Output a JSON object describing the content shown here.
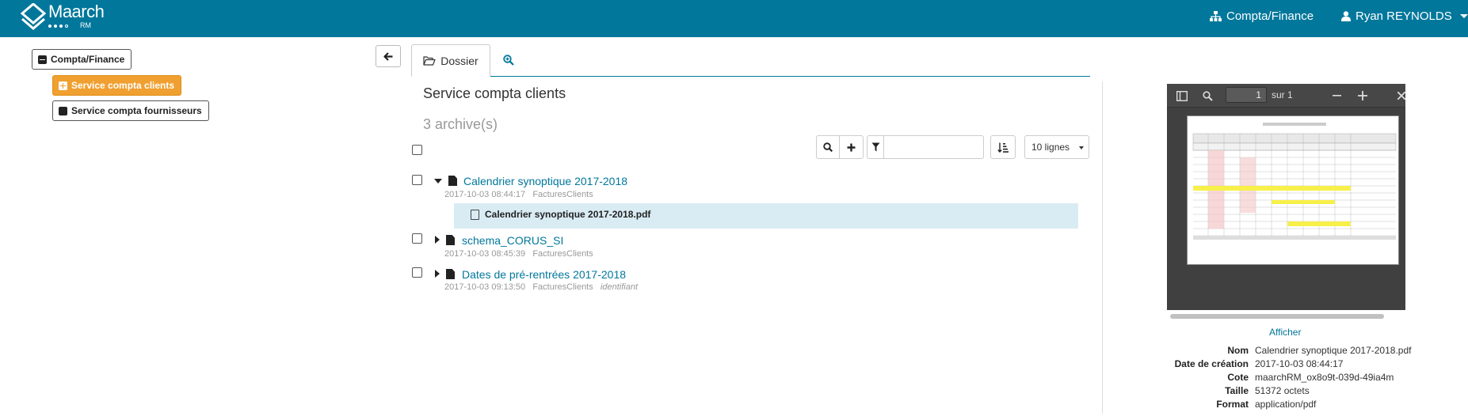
{
  "app": {
    "logo_text": "Maarch",
    "logo_sub": "RM"
  },
  "nav": {
    "org": "Compta/Finance",
    "user": "Ryan REYNOLDS"
  },
  "tree": {
    "root": "Compta/Finance",
    "items": [
      {
        "label": "Service compta clients",
        "active": true
      },
      {
        "label": "Service compta fournisseurs",
        "active": false
      }
    ]
  },
  "tabs": {
    "dossier": "Dossier"
  },
  "folder": {
    "title": "Service compta clients",
    "count": "3 archive(s)"
  },
  "toolbar": {
    "filter_placeholder": "",
    "lines_select": "10 lignes"
  },
  "archives": [
    {
      "title": "Calendrier synoptique 2017-2018",
      "date": "2017-10-03 08:44:17",
      "profile": "FacturesClients",
      "extra": "",
      "expanded": true
    },
    {
      "title": "schema_CORUS_SI",
      "date": "2017-10-03 08:45:39",
      "profile": "FacturesClients",
      "extra": "",
      "expanded": false
    },
    {
      "title": "Dates de pré-rentrées 2017-2018",
      "date": "2017-10-03 09:13:50",
      "profile": "FacturesClients",
      "extra": "identifiant",
      "expanded": false
    }
  ],
  "document": {
    "name": "Calendrier synoptique 2017-2018.pdf"
  },
  "viewer": {
    "page": "1",
    "of": "sur 1"
  },
  "details": {
    "show_link": "Afficher",
    "labels": {
      "name": "Nom",
      "created": "Date de création",
      "cote": "Cote",
      "size": "Taille",
      "format": "Format"
    },
    "values": {
      "name": "Calendrier synoptique 2017-2018.pdf",
      "created": "2017-10-03 08:44:17",
      "cote": "maarchRM_ox8o9t-039d-49ia4m",
      "size": "51372 octets",
      "format": "application/pdf"
    }
  },
  "colors": {
    "primary": "#00779b",
    "accent": "#f0a030",
    "selected_row": "#d9ecf4"
  }
}
